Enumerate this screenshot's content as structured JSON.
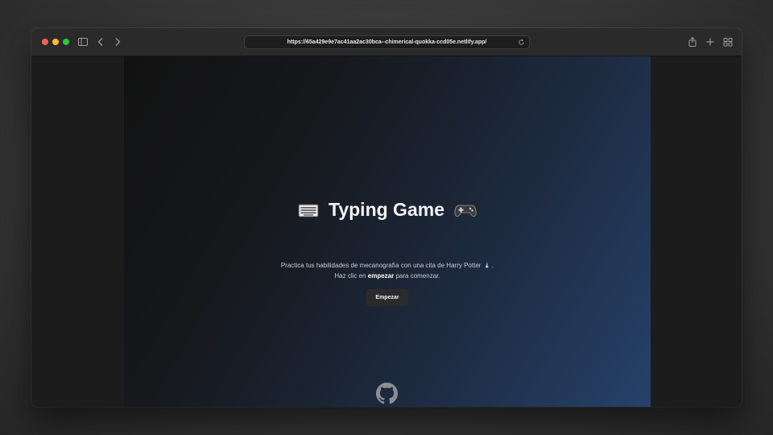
{
  "browser": {
    "url": "https://65a429e9e7ac41aa2ac30bca--chimerical-quokka-ccd05e.netlify.app/"
  },
  "page": {
    "title": "Typing Game",
    "title_left_icon": "keyboard-icon",
    "title_right_icon": "gamepad-icon",
    "description_line1": "Practica tus habilidades de mecanografía con una cita de Harry Potter",
    "description_line1_end": ".",
    "description_icon": "wizard-icon",
    "description_line2_prefix": "Haz clic en",
    "description_line2_bold": "empezar",
    "description_line2_suffix": "para comenzar.",
    "start_button": "Empezar",
    "footer_icon": "github-icon"
  }
}
